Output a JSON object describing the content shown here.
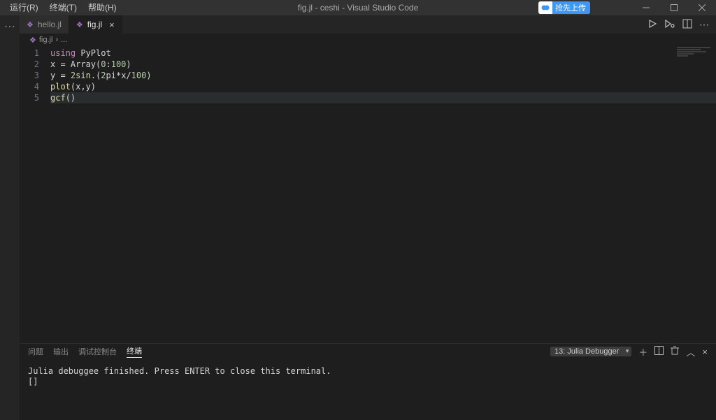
{
  "menu": {
    "run": "运行(R)",
    "terminal": "终端(T)",
    "help": "帮助(H)"
  },
  "window_title": "fig.jl - ceshi - Visual Studio Code",
  "upload_label": "抢先上传",
  "tabs": [
    {
      "label": "hello.jl",
      "icon": "❖"
    },
    {
      "label": "fig.jl",
      "icon": "❖"
    }
  ],
  "active_tab_index": 1,
  "breadcrumb": {
    "file": "fig.jl",
    "sep": "›",
    "tail": "..."
  },
  "code": {
    "lines": [
      {
        "n": "1"
      },
      {
        "n": "2"
      },
      {
        "n": "3"
      },
      {
        "n": "4"
      },
      {
        "n": "5"
      }
    ],
    "l1_kw": "using",
    "l1_mod": " PyPlot",
    "l2_a": "x ",
    "l2_eq": "=",
    "l2_b": " Array(",
    "l2_n1": "0",
    "l2_c": ":",
    "l2_n2": "100",
    "l2_d": ")",
    "l3_a": "y ",
    "l3_eq": "=",
    "l3_b": " ",
    "l3_n1": "2",
    "l3_fn": "sin",
    "l3_c": ".(",
    "l3_n2": "2",
    "l3_pi": "pi",
    "l3_d": "*x/",
    "l3_n3": "100",
    "l3_e": ")",
    "l4_fn": "plot",
    "l4_args": "(x,y)",
    "l5_fn": "gcf",
    "l5_args": "()"
  },
  "panel": {
    "tabs": {
      "problems": "问题",
      "output": "输出",
      "debug": "调试控制台",
      "terminal": "终端"
    },
    "selector": "13: Julia Debugger",
    "line1": "Julia debuggee finished. Press ENTER to close this terminal.",
    "line2": "[]"
  }
}
